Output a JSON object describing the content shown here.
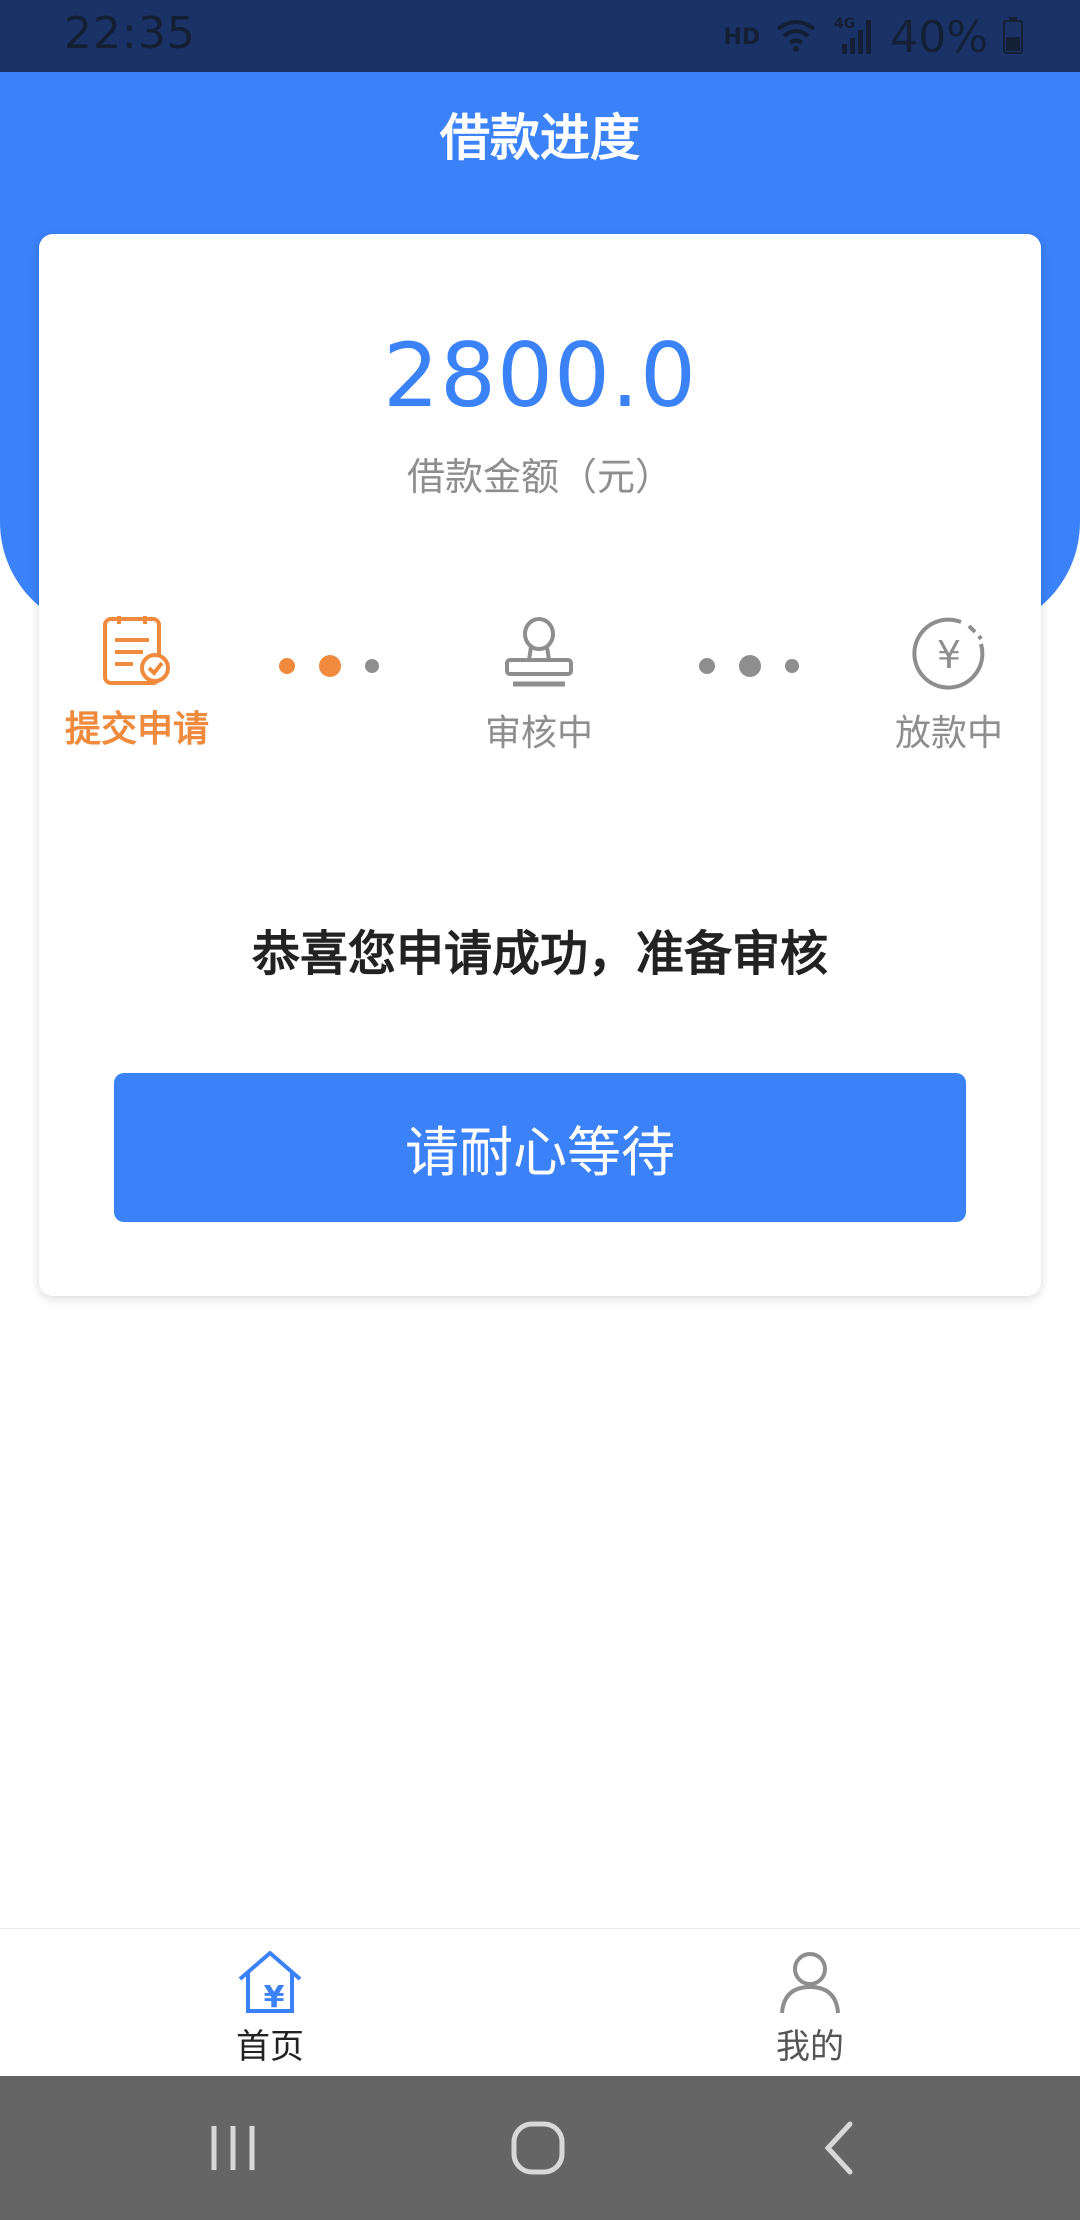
{
  "status_bar": {
    "time": "22:35",
    "network": "HD",
    "battery": "40%",
    "icons": [
      "wifi-icon",
      "signal-4g-icon",
      "battery-icon"
    ]
  },
  "header": {
    "title": "借款进度"
  },
  "loan": {
    "amount": "2800.0",
    "amount_label": "借款金额（元）"
  },
  "steps": [
    {
      "label": "提交申请",
      "icon": "application-form-icon",
      "active": true
    },
    {
      "label": "审核中",
      "icon": "stamp-icon",
      "active": false
    },
    {
      "label": "放款中",
      "icon": "yuan-payout-icon",
      "active": false
    }
  ],
  "message": "恭喜您申请成功，准备审核",
  "wait_button": {
    "label": "请耐心等待"
  },
  "tabbar": {
    "items": [
      {
        "label": "首页",
        "icon": "home-yuan-icon",
        "active": true
      },
      {
        "label": "我的",
        "icon": "user-icon",
        "active": false
      }
    ]
  },
  "colors": {
    "primary": "#3b82f8",
    "active_step": "#f08a3c",
    "inactive": "#8e8e8e",
    "status_bar": "#1b3266",
    "nav_bar": "#656565"
  },
  "system_nav": [
    "recents-icon",
    "home-circle-icon",
    "back-icon"
  ]
}
